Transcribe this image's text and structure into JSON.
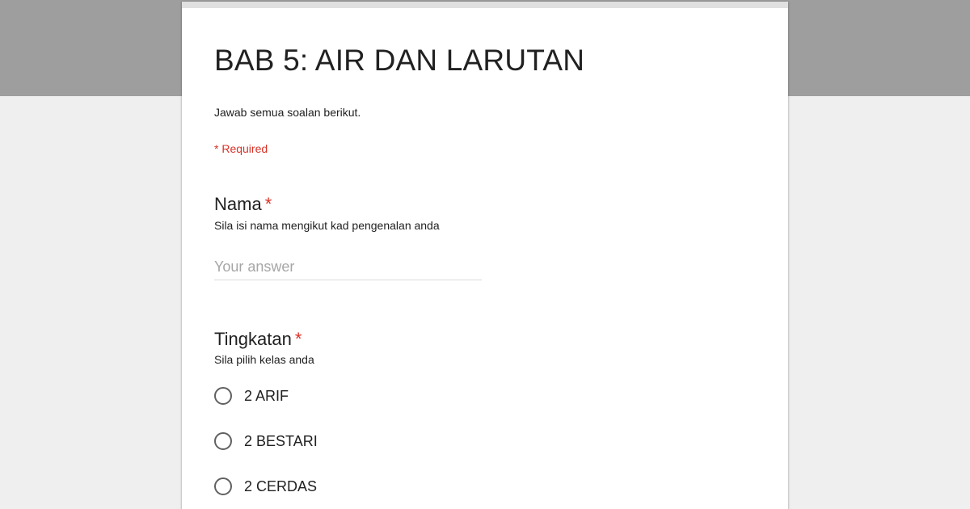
{
  "form": {
    "title": "BAB 5: AIR DAN LARUTAN",
    "description": "Jawab semua soalan berikut.",
    "required_note": "* Required"
  },
  "questions": [
    {
      "title": "Nama",
      "required_mark": "*",
      "help": "Sila isi nama mengikut kad pengenalan anda",
      "input_placeholder": "Your answer",
      "input_value": ""
    },
    {
      "title": "Tingkatan",
      "required_mark": "*",
      "help": "Sila pilih kelas anda",
      "options": [
        "2 ARIF",
        "2 BESTARI",
        "2 CERDAS"
      ]
    }
  ],
  "colors": {
    "header_band": "#9e9e9e",
    "page_background": "#efefef",
    "required_red": "#d93025",
    "text": "#212121"
  }
}
